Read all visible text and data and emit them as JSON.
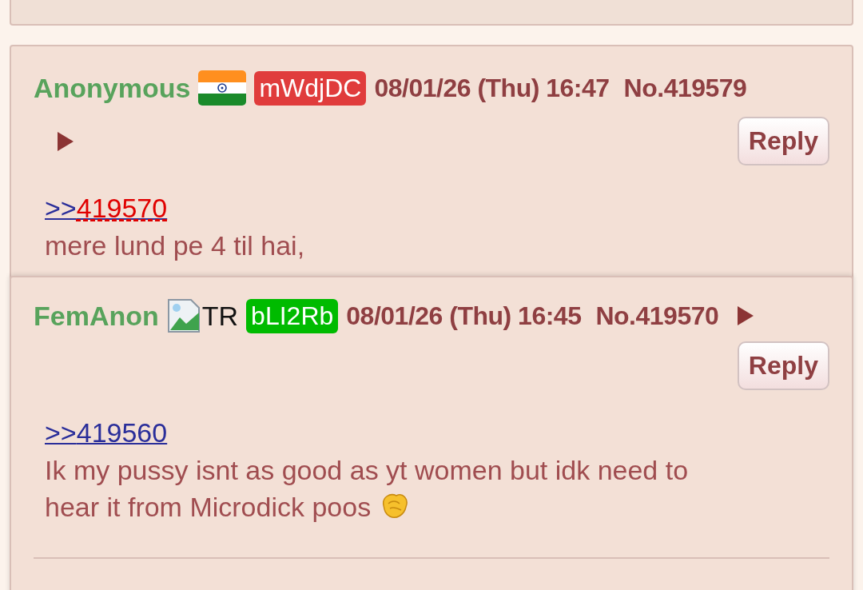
{
  "posts": [
    {
      "kind": "post",
      "name": "Anonymous",
      "flag": {
        "kind": "india"
      },
      "id": {
        "text": "mWdjDC",
        "color": "#e03c3c"
      },
      "date": "08/01/26 (Thu) 16:47",
      "number": "No.419579",
      "reply": "Reply",
      "quote": {
        "arrows": ">>",
        "target": "419570",
        "hovered": true
      },
      "body": [
        {
          "kind": "line",
          "text": "mere lund pe 4 til hai,"
        }
      ]
    },
    {
      "kind": "hover-preview",
      "name": "FemAnon",
      "flag": {
        "kind": "broken-image",
        "label": "TR"
      },
      "id": {
        "text": "bLI2Rb",
        "color": "#00bb00"
      },
      "date": "08/01/26 (Thu) 16:45",
      "number": "No.419570",
      "reply": "Reply",
      "quote": {
        "arrows": ">>",
        "target": "419560",
        "hovered": false
      },
      "body": [
        {
          "kind": "line",
          "text": "Ik my pussy isnt as good as yt women but idk need to"
        },
        {
          "kind": "line",
          "text": "hear it from Microdick poos"
        },
        {
          "kind": "hand-emoji"
        }
      ]
    }
  ]
}
